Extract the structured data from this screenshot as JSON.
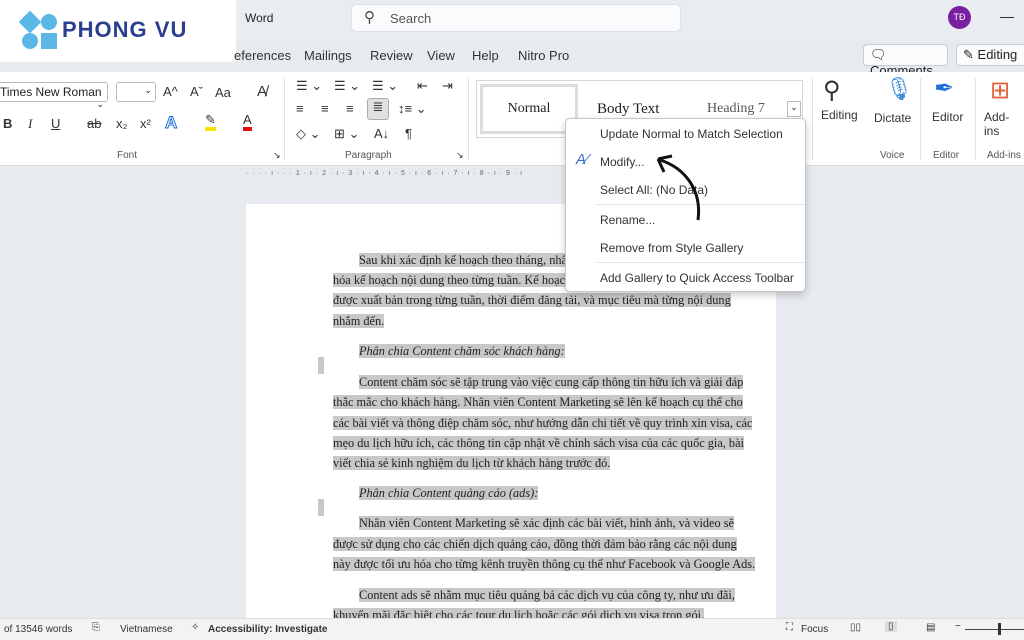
{
  "brand": {
    "logo_text": "PHONG VU"
  },
  "titlebar": {
    "app": "Word",
    "search_placeholder": "Search",
    "avatar": "TĐ",
    "minimize": "—"
  },
  "tabs": [
    "eferences",
    "Mailings",
    "Review",
    "View",
    "Help",
    "Nitro Pro"
  ],
  "top_buttons": {
    "comments": "Comments",
    "editing": "Editing"
  },
  "ribbon": {
    "font": {
      "name": "Times New Roman",
      "size": "",
      "grow": "A^",
      "shrink": "Aˇ",
      "case": "Aa",
      "bold": "B",
      "italic": "I",
      "underline": "U",
      "strike": "ab",
      "sub": "x₂",
      "sup": "x²",
      "label": "Font",
      "highlight_color": "#f5e700",
      "font_color": "#d11"
    },
    "paragraph": {
      "label": "Paragraph",
      "pilcrow": "¶",
      "sort": "A↓"
    },
    "styles": {
      "items": [
        "Normal",
        "Body Text",
        "Heading 7"
      ]
    },
    "editing": "Editing",
    "dictate": "Dictate",
    "voice": "Voice",
    "editor": "Editor",
    "editor_group": "Editor",
    "addins": "Add-ins",
    "addins_group": "Add-ins"
  },
  "ruler": "· · · · ı · · · 1 · ı · 2 · ı · 3 · ı · 4 · ı · 5 · ı · 6 · ı · 7 · ı · 8 · ı · 9 · ı",
  "context_menu": {
    "items": [
      "Update Normal to Match Selection",
      "Modify...",
      "Select All: (No Data)",
      "Rename...",
      "Remove from Style Gallery",
      "Add Gallery to Quick Access Toolbar"
    ]
  },
  "document": {
    "lines": [
      "Sau khi xác định kế hoạch theo tháng, nhân",
      "hóa kế hoạch nội dung theo từng tuần. Kế hoạch",
      "được xuất bản trong từng tuần, thời điểm đăng tải, và mục tiêu mà từng nội dung",
      "nhắm đến.",
      "Phân chia Content chăm sóc khách hàng:",
      "Content chăm sóc sẽ tập trung vào việc cung cấp thông tin hữu ích và giải đáp",
      "thắc mắc cho khách hàng. Nhân viên Content Marketing sẽ lên kế hoạch cụ thể cho",
      "các bài viết và thông điệp chăm sóc, như hướng dẫn chi tiết về quy trình xin visa, các",
      "mẹo du lịch hữu ích, các thông tin cập nhật về chính sách visa của các quốc gia, bài",
      "viết chia sẻ kinh nghiệm du lịch từ khách hàng trước đó.",
      "Phân chia Content quảng cáo (ads):",
      "Nhân viên Content Marketing sẽ xác định các bài viết, hình ảnh, và video sẽ",
      "được sử dụng cho các chiến dịch quảng cáo, đồng thời đảm bảo rằng các nội dung",
      "này được tối ưu hóa cho từng kênh truyền thông cụ thể như Facebook và Google Ads.",
      "Content ads sẽ nhắm mục tiêu quảng bá các dịch vụ của công ty, như ưu đãi,",
      "khuyến mãi đặc biệt cho các tour du lịch hoặc các gói dịch vụ visa trọn gói."
    ]
  },
  "status": {
    "words": "of 13546 words",
    "language": "Vietnamese",
    "accessibility": "Accessibility: Investigate",
    "focus": "Focus"
  }
}
